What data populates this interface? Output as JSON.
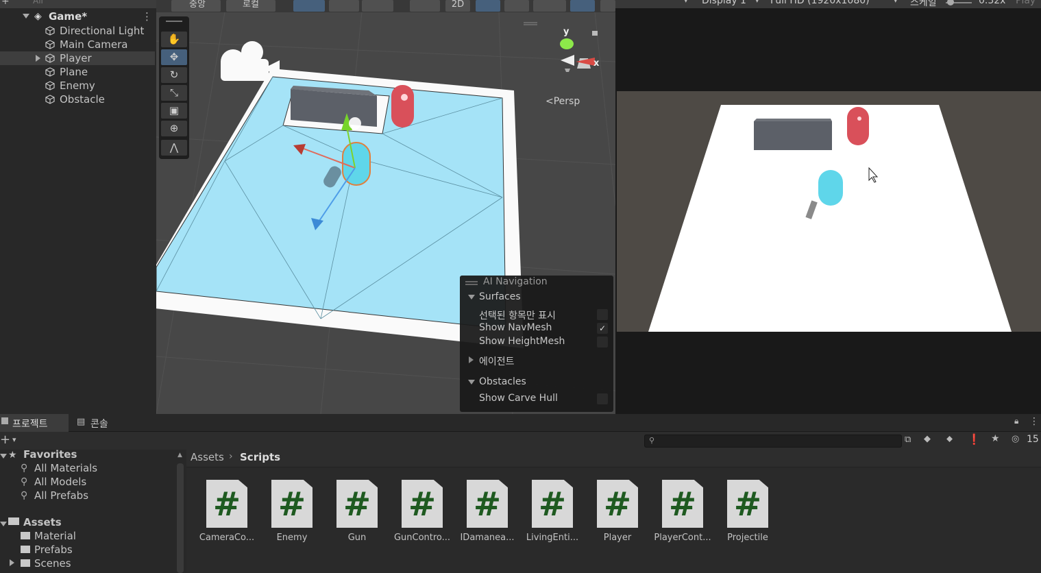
{
  "hierarchy": {
    "search_placeholder": "All",
    "scene_name": "Game*",
    "items": [
      {
        "label": "Directional Light"
      },
      {
        "label": "Main Camera"
      },
      {
        "label": "Player"
      },
      {
        "label": "Plane"
      },
      {
        "label": "Enemy"
      },
      {
        "label": "Obstacle"
      }
    ]
  },
  "scene_toolbar": {
    "pivot_label": "중앙",
    "space_label": "로컬",
    "mode_2d_label": "2D"
  },
  "scene": {
    "persp_label": "Persp",
    "gizmo_y": "y",
    "gizmo_x": "x"
  },
  "ai_navigation": {
    "title": "AI Navigation",
    "surfaces_label": "Surfaces",
    "show_selected_label": "선택된 항목만 표시",
    "show_navmesh_label": "Show NavMesh",
    "show_navmesh_checked": true,
    "show_heightmesh_label": "Show HeightMesh",
    "agents_label": "에이전트",
    "obstacles_label": "Obstacles",
    "show_carve_hull_label": "Show Carve Hull"
  },
  "game_toolbar": {
    "display_label": "Display 1",
    "resolution_label": "Full HD (1920x1080)",
    "scale_label": "스케일",
    "scale_value": "0.32x",
    "play_label": "Play"
  },
  "project": {
    "tab_project": "프로젝트",
    "tab_console": "콘솔",
    "hidden_count": "15",
    "favorites_label": "Favorites",
    "favorites": [
      "All Materials",
      "All Models",
      "All Prefabs"
    ],
    "assets_label": "Assets",
    "folders": [
      "Material",
      "Prefabs",
      "Scenes"
    ],
    "breadcrumb_root": "Assets",
    "breadcrumb_current": "Scripts",
    "scripts": [
      {
        "label": "CameraCo..."
      },
      {
        "label": "Enemy"
      },
      {
        "label": "Gun"
      },
      {
        "label": "GunContro..."
      },
      {
        "label": "IDamanea..."
      },
      {
        "label": "LivingEnti..."
      },
      {
        "label": "Player"
      },
      {
        "label": "PlayerCont..."
      },
      {
        "label": "Projectile"
      }
    ]
  },
  "colors": {
    "navmesh": "#a5e3f7",
    "player": "#5fd6ea",
    "enemy": "#d9505a",
    "selection_blue": "#46607c"
  }
}
